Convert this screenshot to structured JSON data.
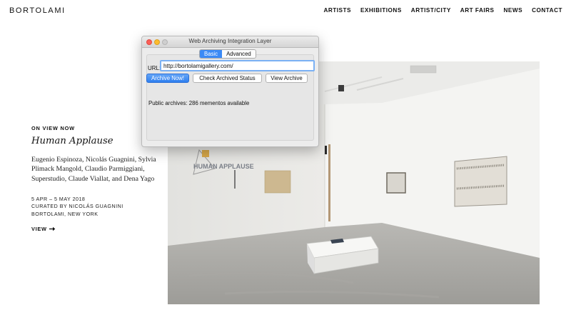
{
  "site": {
    "logo": "BORTOLAMI",
    "nav": [
      "ARTISTS",
      "EXHIBITIONS",
      "ARTIST/CITY",
      "ART FAIRS",
      "NEWS",
      "CONTACT"
    ]
  },
  "exhibition": {
    "kicker": "ON VIEW NOW",
    "title": "Human Applause",
    "artists": "Eugenio Espinoza, Nicolás Guagnini, Sylvia Plimack Mangold, Claudio Parmiggiani, Superstudio, Claude Viallat, and Dena Yago",
    "dates": "5 APR – 5 MAY 2018",
    "curator": "CURATED BY NICOLÁS GUAGNINI",
    "location": "BORTOLAMI, NEW YORK",
    "view_label": "VIEW",
    "view_icon": "arrow-right-icon",
    "artwork_text": "HUMAN APPLAUSE"
  },
  "dialog": {
    "title": "Web Archiving Integration Layer",
    "tabs": [
      {
        "label": "Basic",
        "active": true
      },
      {
        "label": "Advanced",
        "active": false
      }
    ],
    "url_label": "URL:",
    "url_value": "http://bortolamigallery.com/",
    "buttons": {
      "archive_now": "Archive Now!",
      "check_status": "Check Archived Status",
      "view_archive": "View Archive"
    },
    "status_text": "Public archives: 286 mementos available",
    "colors": {
      "accent": "#3b8af6",
      "close": "#fc5f57",
      "minimize": "#fdbc2e"
    }
  }
}
